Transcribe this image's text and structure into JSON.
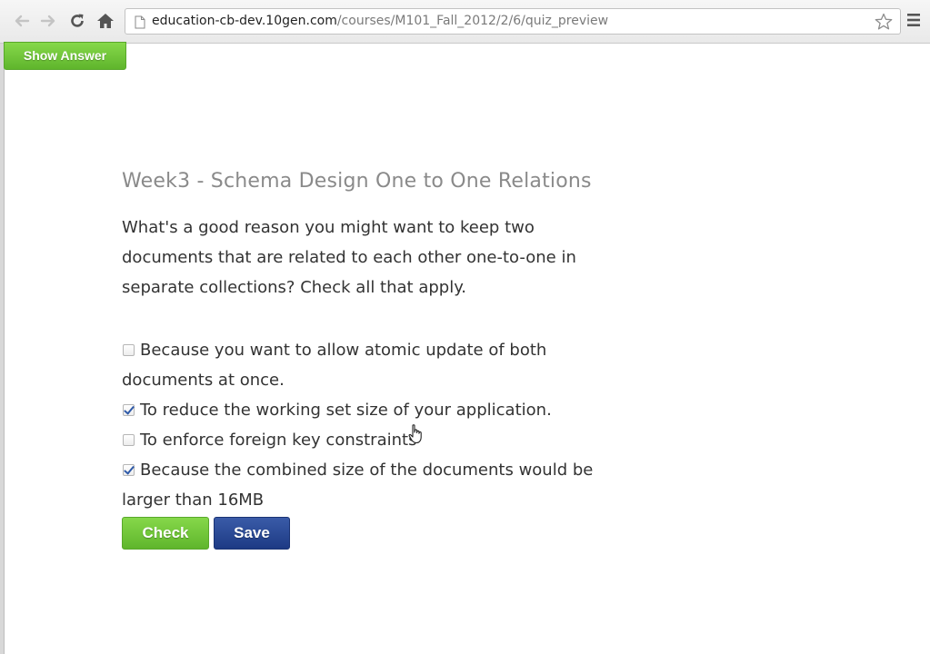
{
  "browser": {
    "url_host": "education-cb-dev.10gen.com",
    "url_path": "/courses/M101_Fall_2012/2/6/quiz_preview"
  },
  "show_answer_label": "Show Answer",
  "quiz": {
    "title": "Week3 - Schema Design One to One Relations",
    "question": "What's a good reason you might want to keep two documents that are related to each other one-to-one in separate collections? Check all that apply.",
    "options": [
      {
        "label": "Because you want to allow atomic update of both documents at once.",
        "checked": false
      },
      {
        "label": "To reduce the working set size of your application.",
        "checked": true
      },
      {
        "label": "To enforce foreign key constraints",
        "checked": false
      },
      {
        "label": "Because the combined size of the documents would be larger than 16MB",
        "checked": true
      }
    ],
    "check_label": "Check",
    "save_label": "Save"
  },
  "colors": {
    "green_button": "#5fb52c",
    "blue_button": "#1d3a84",
    "title_gray": "#8a8a8a",
    "checkmark": "#2f5aa8"
  },
  "icons": [
    "back-arrow-icon",
    "forward-arrow-icon",
    "reload-icon",
    "home-icon",
    "page-icon",
    "star-icon",
    "menu-icon",
    "hand-cursor-icon"
  ]
}
